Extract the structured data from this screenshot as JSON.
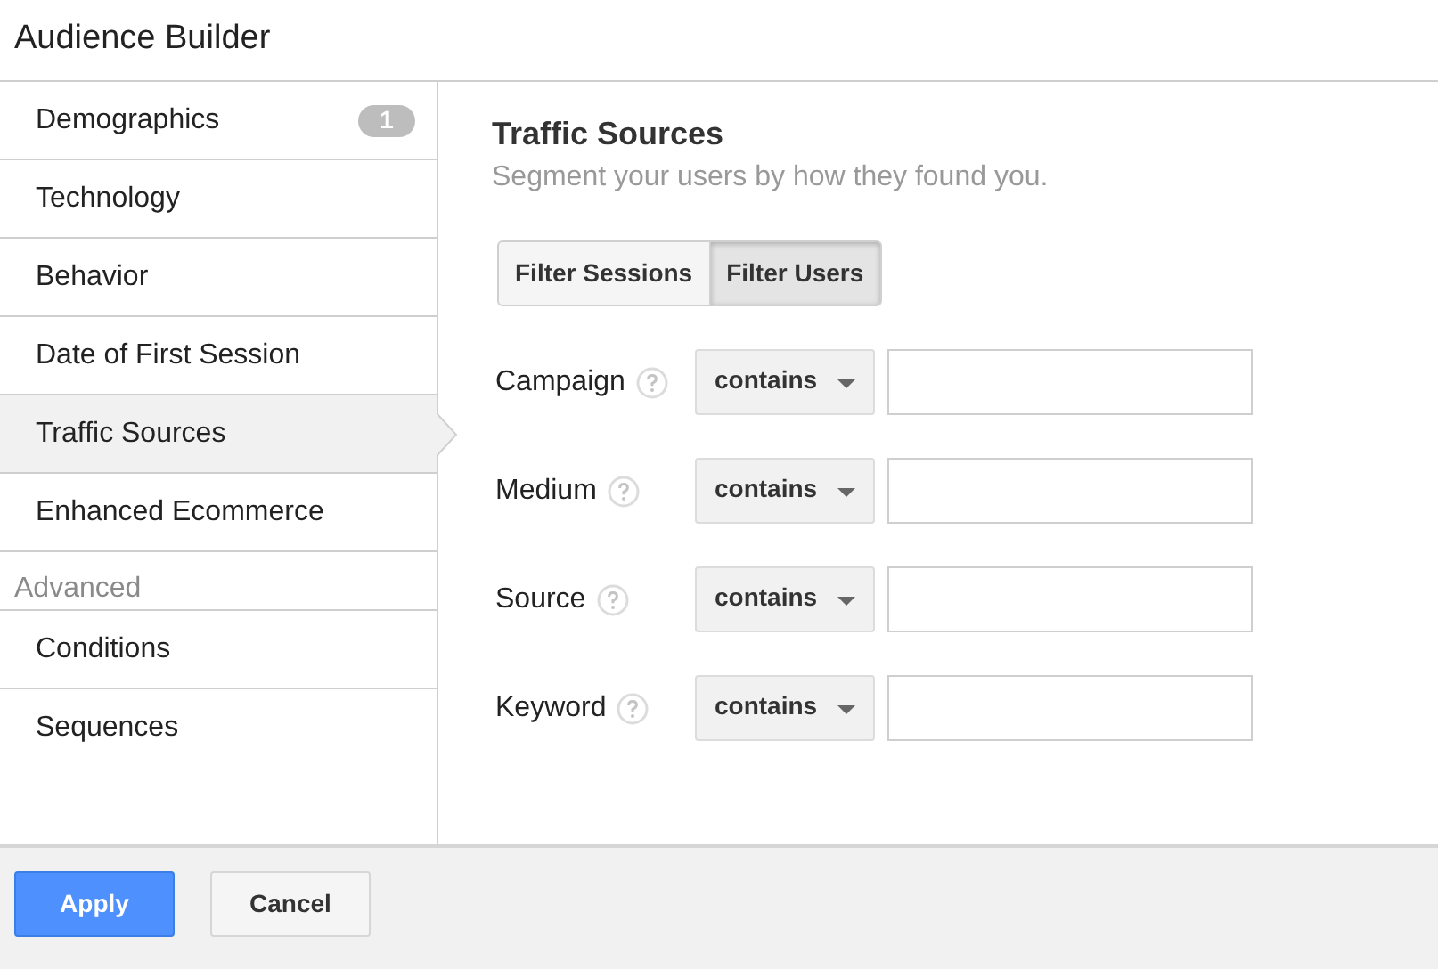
{
  "window": {
    "title": "Audience Builder"
  },
  "sidebar": {
    "items": [
      {
        "label": "Demographics",
        "badge": "1",
        "selected": false
      },
      {
        "label": "Technology",
        "selected": false
      },
      {
        "label": "Behavior",
        "selected": false
      },
      {
        "label": "Date of First Session",
        "selected": false
      },
      {
        "label": "Traffic Sources",
        "selected": true
      },
      {
        "label": "Enhanced Ecommerce",
        "selected": false
      }
    ],
    "section_heading": "Advanced",
    "advanced_items": [
      {
        "label": "Conditions",
        "selected": false
      },
      {
        "label": "Sequences",
        "selected": false
      }
    ]
  },
  "panel": {
    "title": "Traffic Sources",
    "subtitle": "Segment your users by how they found you.",
    "toggle": [
      {
        "label": "Filter Sessions",
        "selected": false
      },
      {
        "label": "Filter Users",
        "selected": true
      }
    ],
    "filters": [
      {
        "label": "Campaign",
        "operator": "contains"
      },
      {
        "label": "Medium",
        "operator": "contains"
      },
      {
        "label": "Source",
        "operator": "contains"
      },
      {
        "label": "Keyword",
        "operator": "contains"
      }
    ]
  },
  "footer": {
    "buttons": [
      {
        "label": "Apply",
        "kind": "primary"
      },
      {
        "label": "Cancel",
        "kind": "secondary"
      }
    ]
  }
}
